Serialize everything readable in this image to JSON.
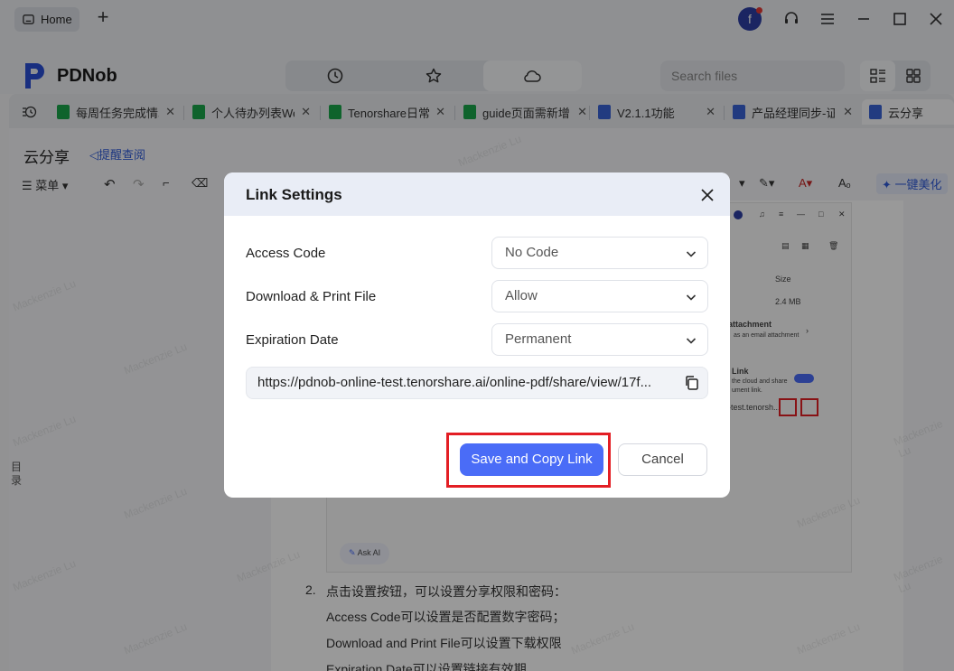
{
  "titlebar": {
    "home_label": "Home",
    "plus_label": "+",
    "avatar_letter": "f"
  },
  "appbar": {
    "app_name": "PDNob",
    "search_placeholder": "Search files"
  },
  "doctabs": [
    {
      "label": "每周任务完成情况",
      "color": "#1aa64a"
    },
    {
      "label": "个人待办列表We",
      "color": "#1aa64a"
    },
    {
      "label": "Tenorshare日常",
      "color": "#1aa64a"
    },
    {
      "label": "guide页面需新增",
      "color": "#1aa64a"
    },
    {
      "label": "V2.1.1功能",
      "color": "#3a63d6"
    },
    {
      "label": "产品经理同步-证",
      "color": "#3a63d6"
    },
    {
      "label": "云分享",
      "color": "#3a63d6"
    }
  ],
  "doc": {
    "title": "云分享",
    "remind_label": "提醒查阅",
    "menu_label": "菜单",
    "beautify_label": "一键美化",
    "sidebar_label_1": "目",
    "sidebar_label_2": "录",
    "list_item_number": "2.",
    "list_item_text": "点击设置按钮，可以设置分享权限和密码：",
    "line_1": "Access Code可以设置是否配置数字密码；",
    "line_2": "Download and Print File可以设置下载权限",
    "line_3": "Expiration Date可以设置链接有效期",
    "watermark": "Mackenzie Lu"
  },
  "embed": {
    "size_label": "Size",
    "size_value": "2.4 MB",
    "attachment_title": "attachment",
    "attachment_sub": "as an email attachment",
    "link_title": "Link",
    "link_sub_1": "the cloud and share",
    "link_sub_2": "ument link.",
    "link_url_frag": "-test.tenorsh...",
    "ask_ai": "Ask AI"
  },
  "modal": {
    "title": "Link Settings",
    "access_code_label": "Access Code",
    "access_code_value": "No Code",
    "download_label": "Download & Print File",
    "download_value": "Allow",
    "expiration_label": "Expiration Date",
    "expiration_value": "Permanent",
    "link_url": "https://pdnob-online-test.tenorshare.ai/online-pdf/share/view/17f...",
    "save_label": "Save and Copy Link",
    "cancel_label": "Cancel"
  },
  "colors": {
    "primary": "#4a6cf7",
    "highlight": "#e31e24",
    "sheet_icon": "#1aa64a",
    "doc_icon": "#3a63d6"
  }
}
